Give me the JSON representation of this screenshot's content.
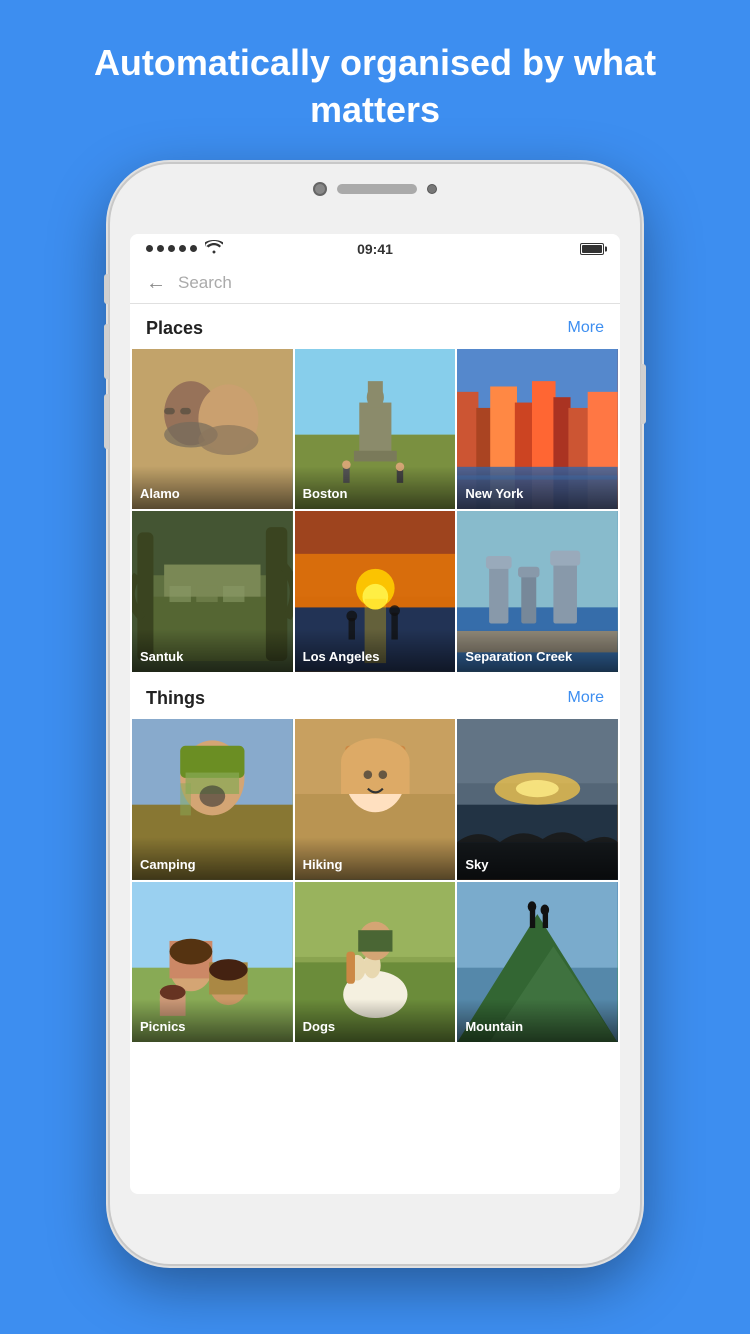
{
  "headline": "Automatically organised by what matters",
  "status": {
    "time": "09:41",
    "wifi": "wifi",
    "battery": 100
  },
  "search": {
    "placeholder": "Search"
  },
  "places": {
    "section_title": "Places",
    "more_label": "More",
    "items": [
      {
        "id": "alamo",
        "label": "Alamo",
        "bg_class": "bg-alamo"
      },
      {
        "id": "boston",
        "label": "Boston",
        "bg_class": "bg-boston"
      },
      {
        "id": "new-york",
        "label": "New York",
        "bg_class": "bg-newyork"
      },
      {
        "id": "santuk",
        "label": "Santuk",
        "bg_class": "bg-santuk"
      },
      {
        "id": "los-angeles",
        "label": "Los Angeles",
        "bg_class": "bg-losangeles"
      },
      {
        "id": "separation-creek",
        "label": "Separation Creek",
        "bg_class": "bg-separationcreek"
      }
    ]
  },
  "things": {
    "section_title": "Things",
    "more_label": "More",
    "items": [
      {
        "id": "camping",
        "label": "Camping",
        "bg_class": "bg-camping"
      },
      {
        "id": "hiking",
        "label": "Hiking",
        "bg_class": "bg-hiking"
      },
      {
        "id": "sky",
        "label": "Sky",
        "bg_class": "bg-sky"
      },
      {
        "id": "picnics",
        "label": "Picnics",
        "bg_class": "bg-picnics"
      },
      {
        "id": "dogs",
        "label": "Dogs",
        "bg_class": "bg-dogs"
      },
      {
        "id": "mountain",
        "label": "Mountain",
        "bg_class": "bg-mountain"
      }
    ]
  }
}
